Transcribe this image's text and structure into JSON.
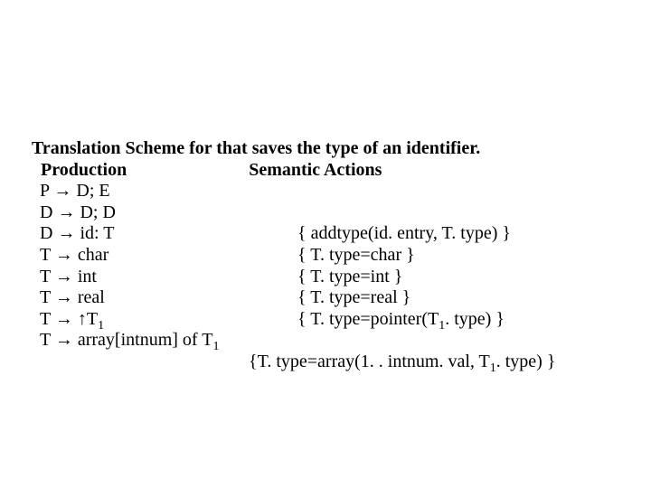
{
  "title": {
    "part1": "Translation Scheme for ",
    "part2": "that saves the type of an identifier."
  },
  "headers": {
    "production": "Production",
    "actions": "Semantic Actions"
  },
  "rules": [
    {
      "production": "P → D; E",
      "action": ""
    },
    {
      "production": "D → D; D",
      "action": ""
    },
    {
      "production": "D → id: T",
      "action": "{ addtype(id. entry, T. type) }"
    },
    {
      "production": "T → char",
      "action": "{ T. type=char }"
    },
    {
      "production": "T → int",
      "action": "{ T. type=int }"
    },
    {
      "production": "T → real",
      "action": "{ T. type=real }"
    }
  ],
  "rule_pointer": {
    "prod_pre": "T → ↑T",
    "prod_sub": "1",
    "act_pre": "{ T. type=pointer(T",
    "act_sub": "1",
    "act_post": ". type) }"
  },
  "rule_array": {
    "prod_pre": "T → array[intnum] of T",
    "prod_sub": "1",
    "act_pre": "{T. type=array(1. . intnum. val, T",
    "act_sub": "1",
    "act_post": ". type) }"
  }
}
